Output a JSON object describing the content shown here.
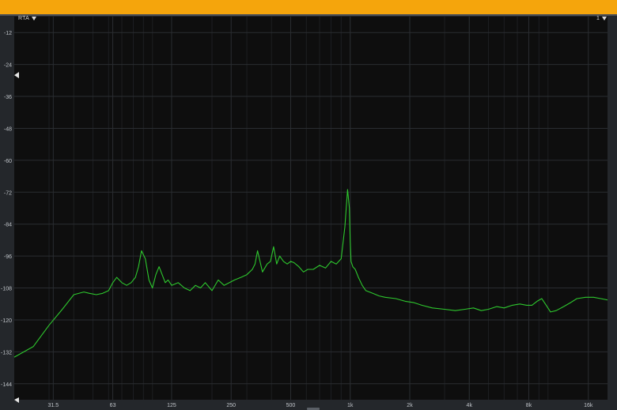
{
  "header": {
    "rta_label": "RTA",
    "channel_label": "1"
  },
  "chart_data": {
    "type": "line",
    "xscale": "log",
    "xlim": [
      20,
      20000
    ],
    "ylim": [
      -150,
      -6
    ],
    "y_ticks": [
      -12,
      -24,
      -36,
      -48,
      -60,
      -72,
      -84,
      -96,
      -108,
      -120,
      -132,
      -144
    ],
    "x_ticks": [
      {
        "value": 31.5,
        "label": "31.5"
      },
      {
        "value": 63,
        "label": "63"
      },
      {
        "value": 125,
        "label": "125"
      },
      {
        "value": 250,
        "label": "250"
      },
      {
        "value": 500,
        "label": "500"
      },
      {
        "value": 1000,
        "label": "1k"
      },
      {
        "value": 2000,
        "label": "2k"
      },
      {
        "value": 4000,
        "label": "4k"
      },
      {
        "value": 8000,
        "label": "8k"
      },
      {
        "value": 16000,
        "label": "16k"
      }
    ],
    "grid": true,
    "series": [
      {
        "color": "#2ec82e",
        "x": [
          20,
          25,
          30,
          35,
          40,
          45,
          48,
          52,
          56,
          60,
          63,
          66,
          70,
          74,
          78,
          82,
          85,
          88,
          92,
          96,
          100,
          104,
          108,
          112,
          116,
          120,
          125,
          135,
          145,
          155,
          165,
          175,
          185,
          200,
          215,
          230,
          245,
          260,
          280,
          300,
          320,
          330,
          340,
          360,
          380,
          395,
          410,
          425,
          440,
          460,
          480,
          500,
          520,
          550,
          580,
          610,
          650,
          700,
          750,
          800,
          850,
          900,
          940,
          970,
          990,
          1000,
          1010,
          1030,
          1060,
          1100,
          1150,
          1200,
          1300,
          1400,
          1500,
          1700,
          1900,
          2100,
          2300,
          2600,
          3000,
          3400,
          3800,
          4200,
          4600,
          5000,
          5500,
          6000,
          6600,
          7200,
          7800,
          8300,
          8800,
          9300,
          9800,
          10300,
          11000,
          12000,
          13000,
          14000,
          15500,
          17000,
          18500,
          20000
        ],
        "y": [
          -134,
          -130,
          -122,
          -116,
          -110.5,
          -109.5,
          -110,
          -110.5,
          -110,
          -109,
          -106,
          -104,
          -106,
          -107,
          -106,
          -104,
          -100,
          -94,
          -97,
          -105,
          -108,
          -103,
          -100,
          -103,
          -106,
          -105,
          -107,
          -106,
          -108,
          -109,
          -107,
          -108,
          -106,
          -109,
          -105,
          -107,
          -106,
          -105,
          -104,
          -103,
          -101,
          -99,
          -94,
          -102,
          -99,
          -98,
          -92.5,
          -99,
          -96,
          -98,
          -99,
          -98,
          -98.5,
          -100,
          -102,
          -101,
          -101,
          -99.5,
          -100.5,
          -98,
          -99,
          -97,
          -85,
          -71,
          -78,
          -90,
          -98,
          -100,
          -101,
          -104,
          -107,
          -109,
          -110,
          -111,
          -111.5,
          -112,
          -113,
          -113.5,
          -114.5,
          -115.5,
          -116,
          -116.5,
          -116,
          -115.5,
          -116.5,
          -116,
          -115,
          -115.5,
          -114.5,
          -114,
          -114.5,
          -114.5,
          -113,
          -112,
          -114.5,
          -117,
          -116.5,
          -115,
          -113.5,
          -112,
          -111.5,
          -111.5,
          -112,
          -112.5
        ]
      }
    ]
  }
}
